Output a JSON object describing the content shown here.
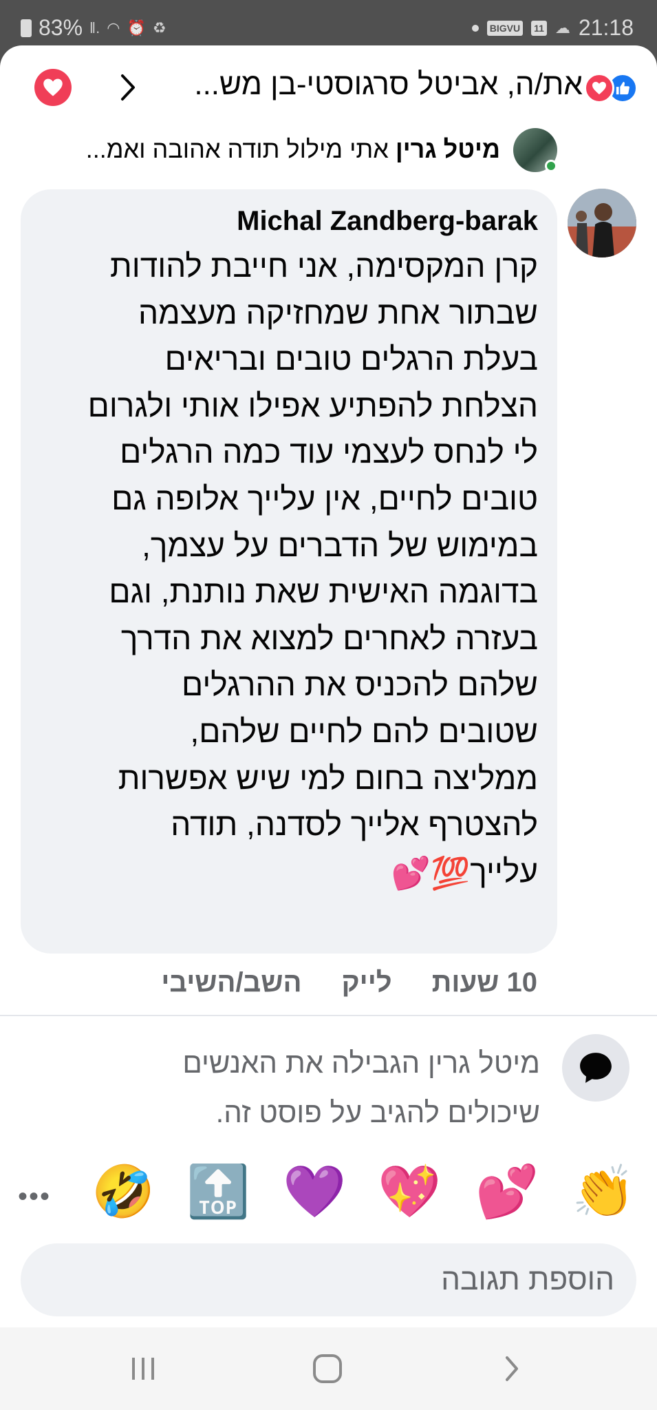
{
  "status_bar": {
    "battery": "83%",
    "time": "21:18",
    "carrier_badge": "BIGVU",
    "calendar_badge": "11"
  },
  "header": {
    "title": "את/ה, אביטל סרגוסטי-בן מש...",
    "reactions": [
      "like-icon",
      "love-icon"
    ],
    "accent_color": "#f03e57"
  },
  "topper": {
    "author": "מיטל גרין",
    "text": "אתי מילול תודה אהובה ואמ..."
  },
  "comment": {
    "author": "Michal Zandberg-barak",
    "lines": [
      "קרן המקסימה, אני חייבת להודות",
      "שבתור אחת שמחזיקה מעצמה",
      "בעלת הרגלים טובים ובריאים",
      "הצלחת להפתיע אפילו אותי ולגרום",
      "לי לנחס לעצמי עוד כמה הרגלים",
      "טובים לחיים, אין עלייך אלופה גם",
      "במימוש של הדברים על עצמך,",
      "בדוגמה האישית שאת נותנת, וגם",
      "בעזרה לאחרים למצוא את הדרך",
      "שלהם להכניס את ההרגלים",
      "שטובים להם לחיים שלהם,",
      "ממליצה בחום למי שיש אפשרות",
      "להצטרף אלייך לסדנה, תודה",
      "עלייך"
    ],
    "trailing_emojis": [
      "💯",
      "💕"
    ],
    "time": "10 שעות",
    "like_label": "לייק",
    "reply_label": "השב/השיבי"
  },
  "limit_notice": {
    "line1": "מיטל גרין הגבילה את האנשים",
    "line2": "שיכולים להגיב על פוסט זה."
  },
  "quick_reactions": [
    "👏",
    "💕",
    "💖",
    "💜",
    "🔝",
    "🤣"
  ],
  "reply_input": {
    "placeholder": "הוספת תגובה"
  }
}
